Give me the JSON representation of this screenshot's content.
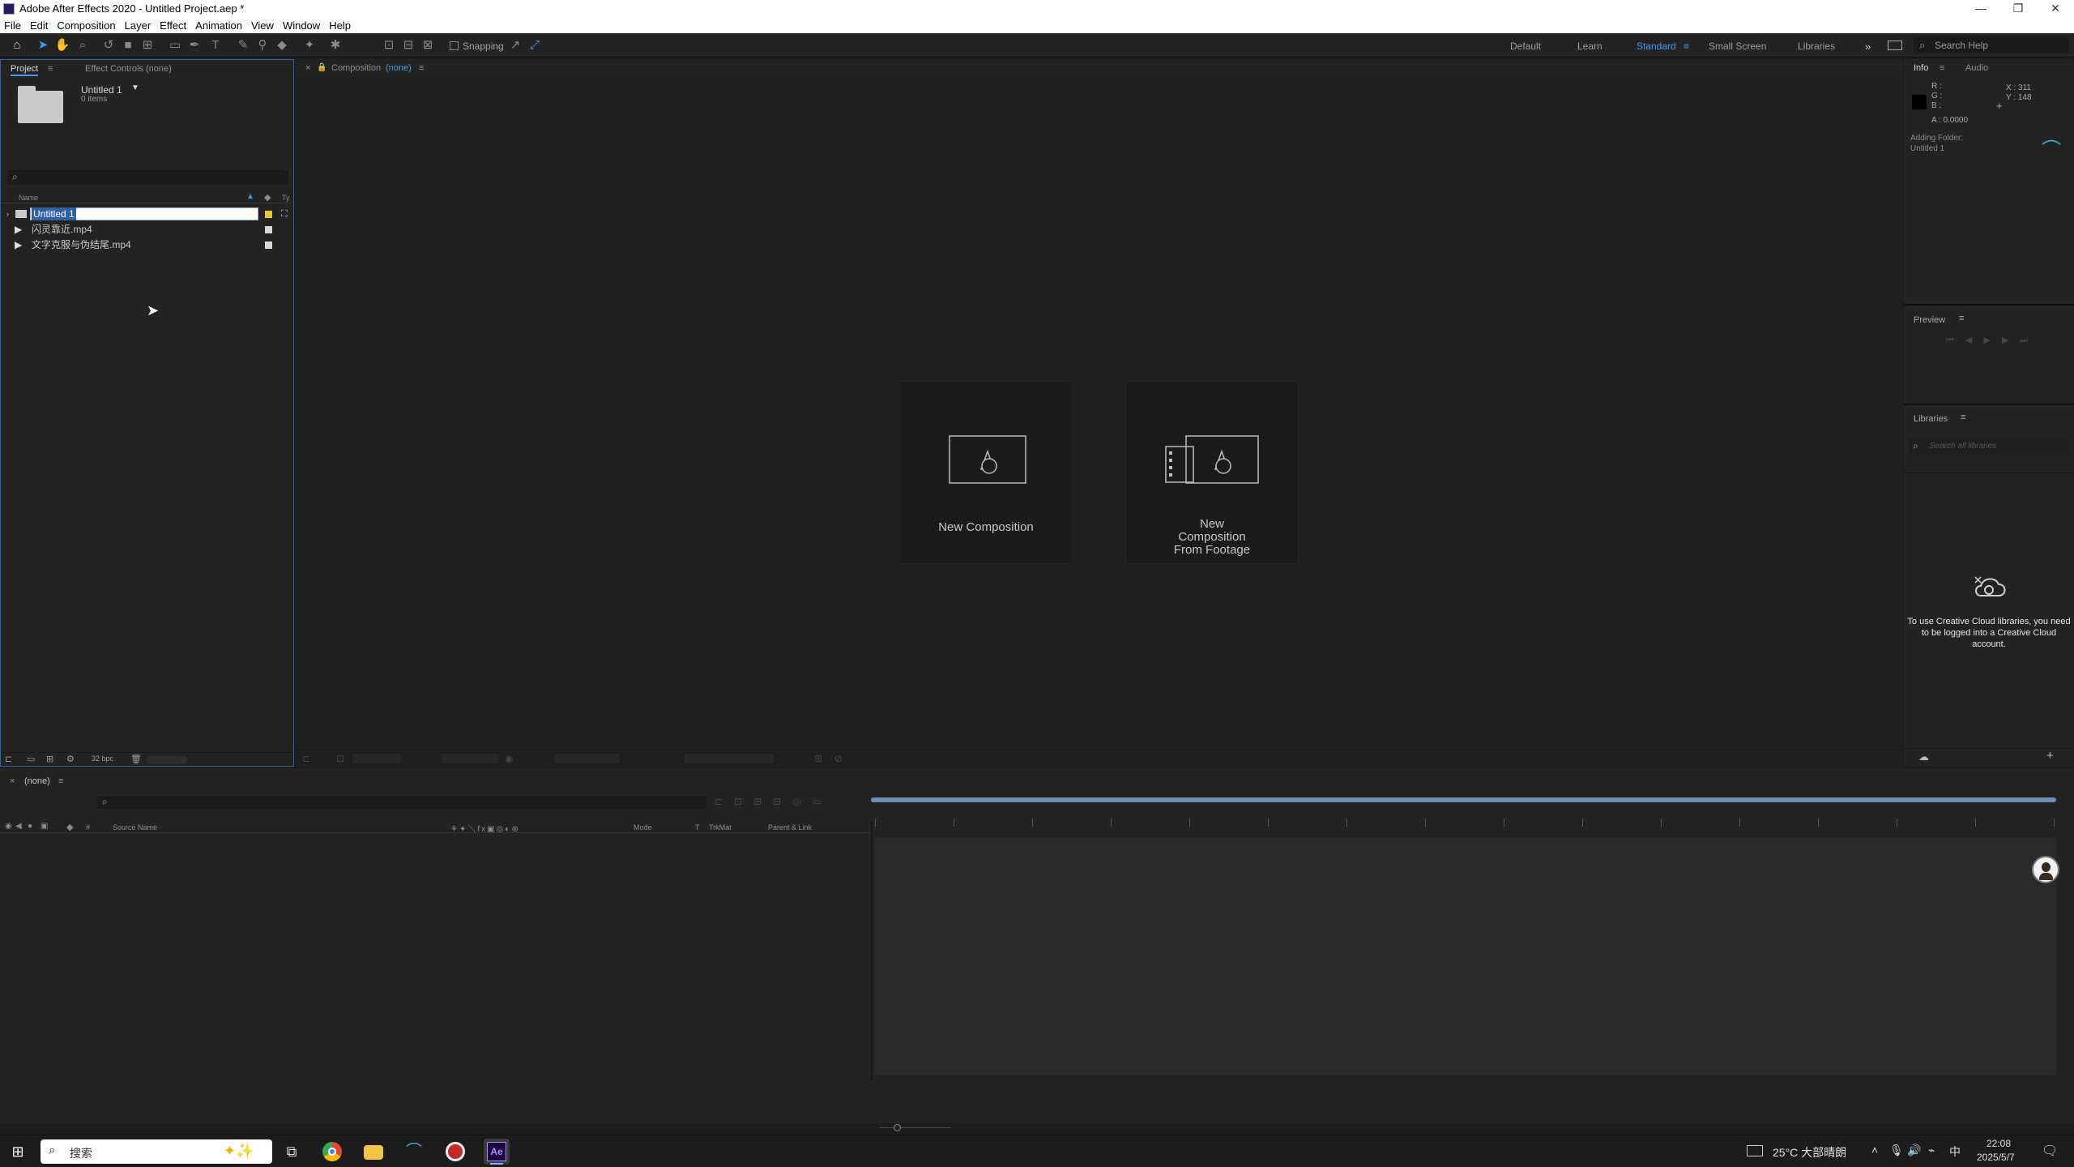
{
  "window": {
    "title": "Adobe After Effects 2020 - Untitled Project.aep *",
    "minimize": "—",
    "restore": "❐",
    "close": "✕"
  },
  "menu": [
    "File",
    "Edit",
    "Composition",
    "Layer",
    "Effect",
    "Animation",
    "View",
    "Window",
    "Help"
  ],
  "toolbar": {
    "snapping_label": "Snapping",
    "workspaces": [
      "Default",
      "Learn",
      "Standard",
      "Small Screen",
      "Libraries"
    ],
    "active_workspace": "Standard",
    "search_placeholder": "Search Help"
  },
  "project": {
    "tabs": [
      "Project",
      "Effect Controls (none)"
    ],
    "folder_name": "Untitled 1",
    "folder_items": "0 items",
    "column_name": "Name",
    "column_type": "Ty",
    "rows": [
      {
        "name": "Untitled 1",
        "kind": "folder",
        "label_color": "#e8c82a",
        "selected": true
      },
      {
        "name": "闪灵靠近.mp4",
        "kind": "footage",
        "label_color": "#d8d8d8",
        "selected": false
      },
      {
        "name": "文字克服与伪结尾.mp4",
        "kind": "footage",
        "label_color": "#d8d8d8",
        "selected": false
      }
    ],
    "bpc": "32 bpc"
  },
  "composition": {
    "tab_label": "Composition",
    "tab_value": "(none)",
    "card_new_comp": "New Composition",
    "card_from_footage_lines": [
      "New",
      "Composition",
      "From Footage"
    ]
  },
  "info": {
    "tabs": [
      "Info",
      "Audio"
    ],
    "r": "R :",
    "g": "G :",
    "b": "B :",
    "a": "A : 0.0000",
    "x": "X : 311",
    "y": "Y : 148",
    "status_line1": "Adding Folder:",
    "status_line2": "Untitled 1"
  },
  "preview": {
    "title": "Preview"
  },
  "libraries": {
    "title": "Libraries",
    "search_placeholder": "Search all libraries",
    "message": "To use Creative Cloud libraries, you need to be logged into a Creative Cloud account."
  },
  "timeline": {
    "tab_label": "(none)",
    "columns": {
      "hash": "#",
      "source_name": "Source Name",
      "mode": "Mode",
      "t": "T",
      "trkmat": "TrkMat",
      "parent": "Parent & Link"
    }
  },
  "taskbar": {
    "search_label": "搜索",
    "weather": "25°C 大部晴朗",
    "ime": "中",
    "time": "22:08",
    "date": "2025/5/7",
    "ae_label": "Ae"
  },
  "colors": {
    "accent_blue": "#3d9bf2",
    "panel_bg": "#232323",
    "selection_border": "#2d62a8"
  }
}
